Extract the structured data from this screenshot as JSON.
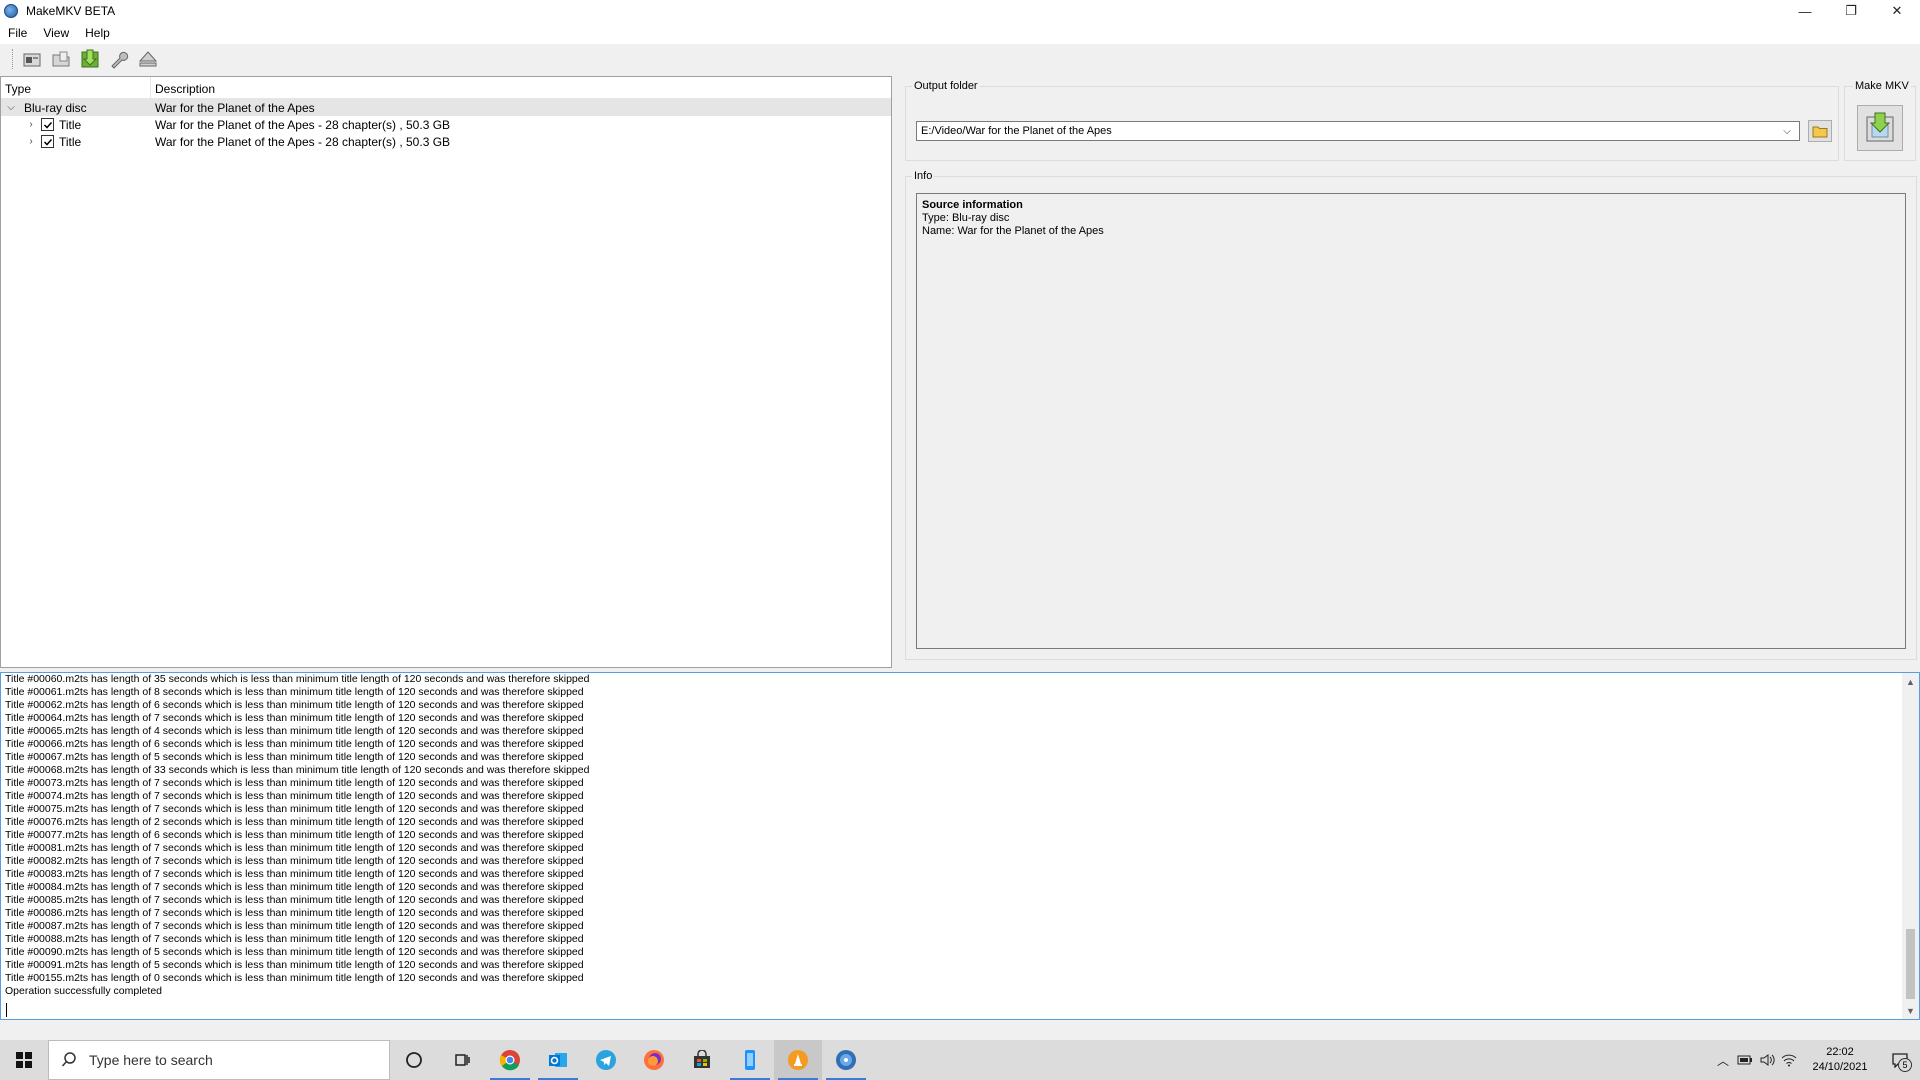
{
  "window": {
    "title": "MakeMKV BETA",
    "controls": {
      "minimize": "—",
      "restore": "❐",
      "close": "✕"
    }
  },
  "menu": [
    "File",
    "View",
    "Help"
  ],
  "toolbar": [
    "open-disc-icon",
    "open-files-icon",
    "make-mkv-icon",
    "settings-wrench-icon",
    "eject-icon"
  ],
  "tree": {
    "columns": {
      "type": "Type",
      "description": "Description"
    },
    "disc": {
      "type": "Blu-ray disc",
      "description": "War for the Planet of the Apes"
    },
    "titles": [
      {
        "type": "Title",
        "description": "War for the Planet of the Apes - 28 chapter(s) , 50.3 GB",
        "checked": true
      },
      {
        "type": "Title",
        "description": "War for the Planet of the Apes - 28 chapter(s) , 50.3 GB",
        "checked": true
      }
    ]
  },
  "output_folder": {
    "label": "Output folder",
    "value": "E:/Video/War for the Planet of the Apes"
  },
  "make_mkv": {
    "label": "Make MKV"
  },
  "info": {
    "label": "Info",
    "heading": "Source information",
    "type_line": "Type: Blu-ray disc",
    "name_line": "Name: War for the Planet of the Apes"
  },
  "log": [
    "Title #00060.m2ts has length of 35 seconds which is less than minimum title length of 120 seconds and was therefore skipped",
    "Title #00061.m2ts has length of 8 seconds which is less than minimum title length of 120 seconds and was therefore skipped",
    "Title #00062.m2ts has length of 6 seconds which is less than minimum title length of 120 seconds and was therefore skipped",
    "Title #00064.m2ts has length of 7 seconds which is less than minimum title length of 120 seconds and was therefore skipped",
    "Title #00065.m2ts has length of 4 seconds which is less than minimum title length of 120 seconds and was therefore skipped",
    "Title #00066.m2ts has length of 6 seconds which is less than minimum title length of 120 seconds and was therefore skipped",
    "Title #00067.m2ts has length of 5 seconds which is less than minimum title length of 120 seconds and was therefore skipped",
    "Title #00068.m2ts has length of 33 seconds which is less than minimum title length of 120 seconds and was therefore skipped",
    "Title #00073.m2ts has length of 7 seconds which is less than minimum title length of 120 seconds and was therefore skipped",
    "Title #00074.m2ts has length of 7 seconds which is less than minimum title length of 120 seconds and was therefore skipped",
    "Title #00075.m2ts has length of 7 seconds which is less than minimum title length of 120 seconds and was therefore skipped",
    "Title #00076.m2ts has length of 2 seconds which is less than minimum title length of 120 seconds and was therefore skipped",
    "Title #00077.m2ts has length of 6 seconds which is less than minimum title length of 120 seconds and was therefore skipped",
    "Title #00081.m2ts has length of 7 seconds which is less than minimum title length of 120 seconds and was therefore skipped",
    "Title #00082.m2ts has length of 7 seconds which is less than minimum title length of 120 seconds and was therefore skipped",
    "Title #00083.m2ts has length of 7 seconds which is less than minimum title length of 120 seconds and was therefore skipped",
    "Title #00084.m2ts has length of 7 seconds which is less than minimum title length of 120 seconds and was therefore skipped",
    "Title #00085.m2ts has length of 7 seconds which is less than minimum title length of 120 seconds and was therefore skipped",
    "Title #00086.m2ts has length of 7 seconds which is less than minimum title length of 120 seconds and was therefore skipped",
    "Title #00087.m2ts has length of 7 seconds which is less than minimum title length of 120 seconds and was therefore skipped",
    "Title #00088.m2ts has length of 7 seconds which is less than minimum title length of 120 seconds and was therefore skipped",
    "Title #00090.m2ts has length of 5 seconds which is less than minimum title length of 120 seconds and was therefore skipped",
    "Title #00091.m2ts has length of 5 seconds which is less than minimum title length of 120 seconds and was therefore skipped",
    "Title #00155.m2ts has length of 0 seconds which is less than minimum title length of 120 seconds and was therefore skipped",
    "Operation successfully completed"
  ],
  "taskbar": {
    "search_placeholder": "Type here to search",
    "apps": [
      "cortana-icon",
      "task-view-icon",
      "chrome-icon",
      "outlook-icon",
      "telegram-icon",
      "firefox-icon",
      "store-icon",
      "phone-icon",
      "vlc-icon",
      "makemkv-taskbar-icon"
    ],
    "time": "22:02",
    "date": "24/10/2021",
    "notification_count": "5"
  },
  "colors": {
    "accent": "#569de5",
    "selection": "#e5e5e5",
    "taskbar": "#dcdcdc"
  }
}
